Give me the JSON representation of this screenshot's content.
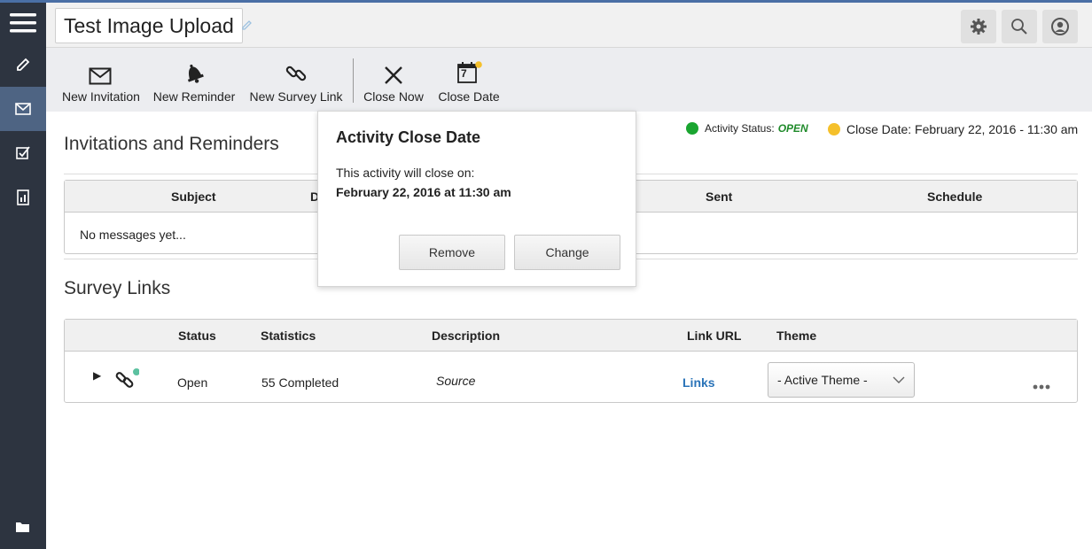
{
  "header": {
    "title": "Test Image Upload"
  },
  "sidebar": {
    "items": [
      {
        "icon": "pencil-icon"
      },
      {
        "icon": "envelope-icon",
        "active": true
      },
      {
        "icon": "checklist-icon"
      },
      {
        "icon": "report-icon"
      }
    ],
    "bottom_icon": "folder-icon"
  },
  "toolbar": {
    "new_invitation": "New Invitation",
    "new_reminder": "New Reminder",
    "new_survey_link": "New Survey Link",
    "close_now": "Close Now",
    "close_date": "Close Date",
    "calendar_day": "7"
  },
  "status": {
    "activity_label": "Activity Status:",
    "activity_value": "OPEN",
    "close_date_text": "Close Date: February 22, 2016 - 11:30 am",
    "colors": {
      "open": "#1aa530",
      "pending": "#f5c02b",
      "open_text": "#1f8a2a"
    }
  },
  "invitations": {
    "title": "Invitations and Reminders",
    "columns": [
      "Subject",
      "D",
      "Sent",
      "Schedule"
    ],
    "empty_text": "No messages yet..."
  },
  "survey_links": {
    "title": "Survey Links",
    "columns": [
      "Status",
      "Statistics",
      "Description",
      "Link URL",
      "Theme"
    ],
    "rows": [
      {
        "status": "Open",
        "statistics": "55 Completed",
        "description": "Source",
        "link_url": "Links",
        "theme": "- Active Theme -"
      }
    ]
  },
  "popover": {
    "title": "Activity Close Date",
    "line1": "This activity will close on:",
    "line2": "February 22, 2016 at 11:30 am",
    "remove": "Remove",
    "change": "Change"
  },
  "colors": {
    "rail": "#2d3440",
    "rail_active": "#4e6483",
    "link": "#2a73b8"
  }
}
